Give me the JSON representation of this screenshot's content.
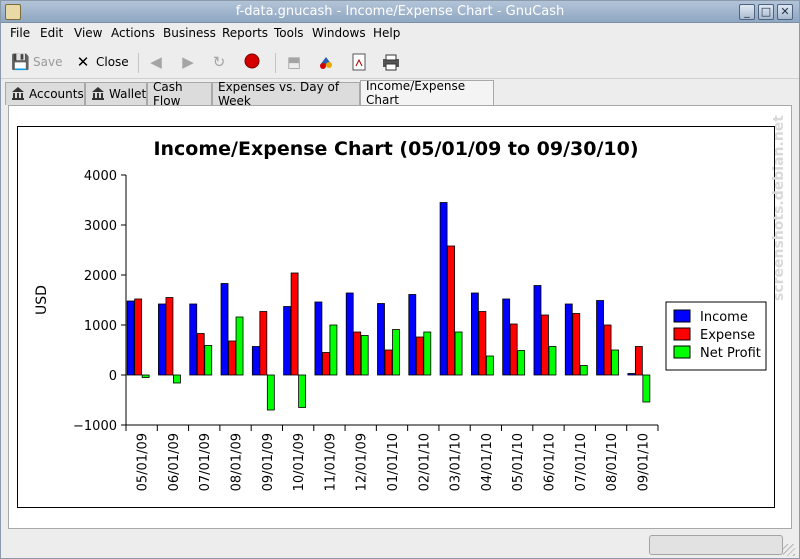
{
  "window": {
    "title": "f-data.gnucash - Income/Expense Chart - GnuCash"
  },
  "menubar": [
    {
      "key": "file",
      "label": "File"
    },
    {
      "key": "edit",
      "label": "Edit"
    },
    {
      "key": "view",
      "label": "View"
    },
    {
      "key": "actions",
      "label": "Actions"
    },
    {
      "key": "business",
      "label": "Business"
    },
    {
      "key": "reports",
      "label": "Reports"
    },
    {
      "key": "tools",
      "label": "Tools"
    },
    {
      "key": "windows",
      "label": "Windows"
    },
    {
      "key": "help",
      "label": "Help"
    }
  ],
  "toolbar": {
    "save_label": "Save",
    "close_label": "Close"
  },
  "tabs": [
    {
      "label": "Accounts",
      "icon": "bank-icon"
    },
    {
      "label": "Wallet",
      "icon": "bank-icon"
    },
    {
      "label": "Cash Flow"
    },
    {
      "label": "Expenses vs. Day of Week"
    },
    {
      "label": "Income/Expense Chart",
      "active": true
    }
  ],
  "watermark": "screenshots.debian.net",
  "chart_data": {
    "type": "bar",
    "title": "Income/Expense Chart (05/01/09 to 09/30/10)",
    "ylabel": "USD",
    "xlabel": "",
    "ylim": [
      -1000,
      4000
    ],
    "yticks": [
      "4000",
      "3000",
      "2000",
      "1000",
      "0",
      "−1000"
    ],
    "grid": false,
    "legend_position": "right",
    "categories": [
      "05/01/09",
      "06/01/09",
      "07/01/09",
      "08/01/09",
      "09/01/09",
      "10/01/09",
      "11/01/09",
      "12/01/09",
      "01/01/10",
      "02/01/10",
      "03/01/10",
      "04/01/10",
      "05/01/10",
      "06/01/10",
      "07/01/10",
      "08/01/10",
      "09/01/10"
    ],
    "series": [
      {
        "name": "Income",
        "color": "#0000ff",
        "values": [
          1480,
          1420,
          1420,
          1830,
          570,
          1370,
          1460,
          1640,
          1430,
          1610,
          3450,
          1640,
          1520,
          1790,
          1420,
          1490,
          30
        ]
      },
      {
        "name": "Expense",
        "color": "#ff0000",
        "values": [
          1520,
          1550,
          830,
          680,
          1270,
          2040,
          450,
          860,
          500,
          760,
          2580,
          1270,
          1020,
          1200,
          1230,
          1000,
          570
        ]
      },
      {
        "name": "Net Profit",
        "color": "#00ff00",
        "values": [
          -50,
          -160,
          590,
          1160,
          -700,
          -650,
          1000,
          790,
          910,
          860,
          860,
          380,
          490,
          570,
          190,
          500,
          -540
        ]
      }
    ]
  }
}
